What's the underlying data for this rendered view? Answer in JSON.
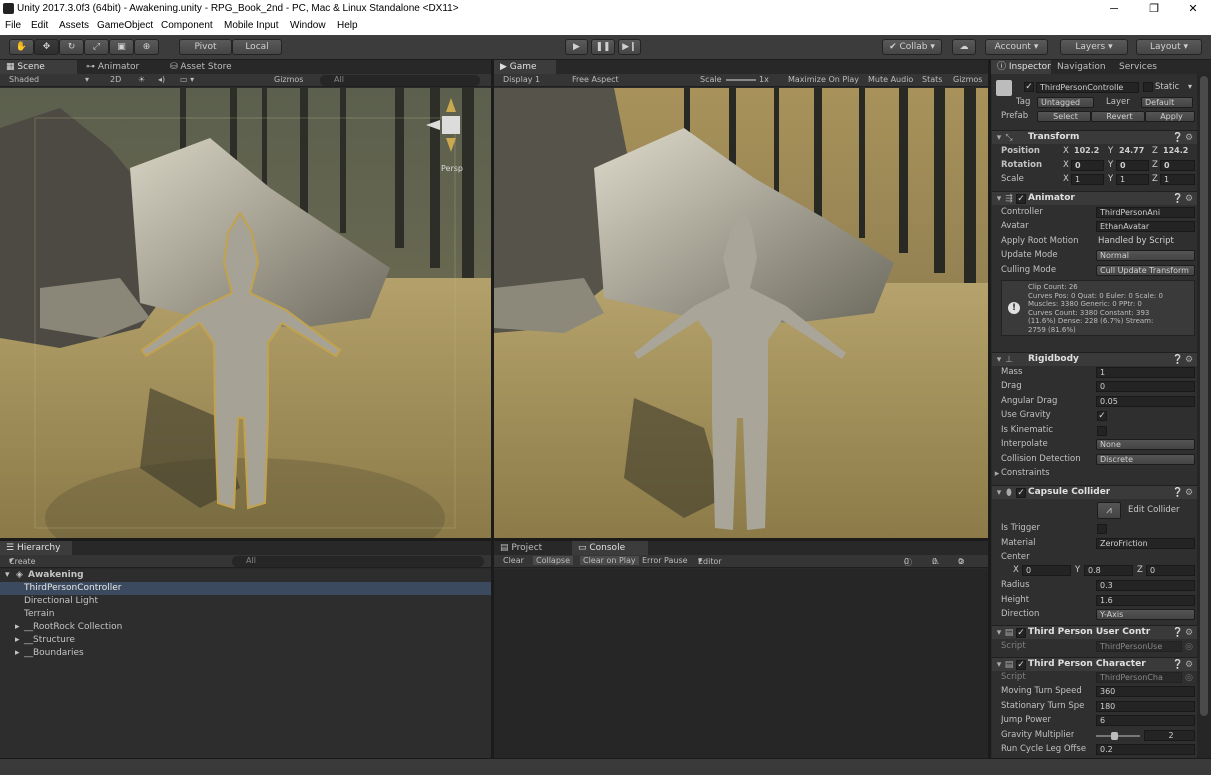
{
  "window": {
    "title": "Unity 2017.3.0f3 (64bit) - Awakening.unity - RPG_Book_2nd - PC, Mac & Linux Standalone <DX11>",
    "minimize": "─",
    "maximize": "❐",
    "close": "✕"
  },
  "menu": [
    "File",
    "Edit",
    "Assets",
    "GameObject",
    "Component",
    "Mobile Input",
    "Window",
    "Help"
  ],
  "toolbar": {
    "pivot": "Pivot",
    "local": "Local",
    "play_icon": "▶",
    "pause_icon": "❚❚",
    "step_icon": "▶❙",
    "collab": "Collab ▾",
    "account": "Account",
    "layers": "Layers",
    "layout": "Layout"
  },
  "scene": {
    "tabs": [
      "Scene",
      "Animator",
      "Asset Store"
    ],
    "shading": "Shaded",
    "mode2d": "2D",
    "gizmos": "Gizmos",
    "search_placeholder": "All",
    "persp": "Persp"
  },
  "game": {
    "tab": "Game",
    "display": "Display 1",
    "aspect": "Free Aspect",
    "scale_label": "Scale",
    "scale_value": "1x",
    "maximize_on_play": "Maximize On Play",
    "mute_audio": "Mute Audio",
    "stats": "Stats",
    "gizmos": "Gizmos"
  },
  "hierarchy": {
    "tab": "Hierarchy",
    "create": "Create",
    "search_placeholder": "All",
    "scene_name": "Awakening",
    "items": [
      {
        "label": "ThirdPersonController",
        "selected": true,
        "expandable": false
      },
      {
        "label": "Directional Light",
        "selected": false,
        "expandable": false
      },
      {
        "label": "Terrain",
        "selected": false,
        "expandable": false
      },
      {
        "label": "__RootRock Collection",
        "selected": false,
        "expandable": true
      },
      {
        "label": "__Structure",
        "selected": false,
        "expandable": true
      },
      {
        "label": "__Boundaries",
        "selected": false,
        "expandable": true
      }
    ]
  },
  "console": {
    "tabs": [
      "Project",
      "Console"
    ],
    "clear": "Clear",
    "collapse": "Collapse",
    "clear_on_play": "Clear on Play",
    "error_pause": "Error Pause",
    "editor": "Editor",
    "info_count": "0",
    "warn_count": "0",
    "error_count": "0"
  },
  "inspector": {
    "tabs": [
      "Inspector",
      "Navigation",
      "Services"
    ],
    "object_name": "ThirdPersonControlle",
    "static": "Static",
    "tag_label": "Tag",
    "tag_value": "Untagged",
    "layer_label": "Layer",
    "layer_value": "Default",
    "prefab_label": "Prefab",
    "prefab_select": "Select",
    "prefab_revert": "Revert",
    "prefab_apply": "Apply",
    "transform": {
      "title": "Transform",
      "position_label": "Position",
      "rotation_label": "Rotation",
      "scale_label": "Scale",
      "position": [
        "102.2",
        "24.77",
        "124.2"
      ],
      "rotation": [
        "0",
        "0",
        "0"
      ],
      "scale": [
        "1",
        "1",
        "1"
      ]
    },
    "animator": {
      "title": "Animator",
      "controller_label": "Controller",
      "controller_value": "ThirdPersonAni",
      "avatar_label": "Avatar",
      "avatar_value": "EthanAvatar",
      "apply_root_label": "Apply Root Motion",
      "apply_root_value": "Handled by Script",
      "update_mode_label": "Update Mode",
      "update_mode_value": "Normal",
      "culling_label": "Culling Mode",
      "culling_value": "Cull Update Transform",
      "info": [
        "Clip Count: 26",
        "Curves Pos: 0 Quat: 0 Euler: 0 Scale: 0",
        "Muscles: 3380 Generic: 0 PPtr: 0",
        "Curves Count: 3380 Constant: 393",
        "(11.6%) Dense: 228 (6.7%) Stream:",
        "2759 (81.6%)"
      ]
    },
    "rigidbody": {
      "title": "Rigidbody",
      "mass_label": "Mass",
      "mass": "1",
      "drag_label": "Drag",
      "drag": "0",
      "angular_drag_label": "Angular Drag",
      "angular_drag": "0.05",
      "use_gravity_label": "Use Gravity",
      "use_gravity": "✓",
      "is_kinematic_label": "Is Kinematic",
      "interpolate_label": "Interpolate",
      "interpolate": "None",
      "collision_label": "Collision Detection",
      "collision": "Discrete",
      "constraints_label": "Constraints"
    },
    "capsule": {
      "title": "Capsule Collider",
      "edit_collider": "Edit Collider",
      "is_trigger_label": "Is Trigger",
      "material_label": "Material",
      "material": "ZeroFriction",
      "center_label": "Center",
      "center": [
        "0",
        "0.8",
        "0"
      ],
      "radius_label": "Radius",
      "radius": "0.3",
      "height_label": "Height",
      "height": "1.6",
      "direction_label": "Direction",
      "direction": "Y-Axis"
    },
    "user_control": {
      "title": "Third Person User Contr",
      "script_label": "Script",
      "script": "ThirdPersonUse"
    },
    "character": {
      "title": "Third Person Character",
      "script_label": "Script",
      "script": "ThirdPersonCha",
      "moving_turn_label": "Moving Turn Speed",
      "moving_turn": "360",
      "stationary_turn_label": "Stationary Turn Spe",
      "stationary_turn": "180",
      "jump_power_label": "Jump Power",
      "jump_power": "6",
      "gravity_mult_label": "Gravity Multiplier",
      "gravity_mult": "2",
      "run_cycle_label": "Run Cycle Leg Offse",
      "run_cycle": "0.2"
    }
  },
  "axis": {
    "x": "X",
    "y": "Y",
    "z": "Z"
  }
}
